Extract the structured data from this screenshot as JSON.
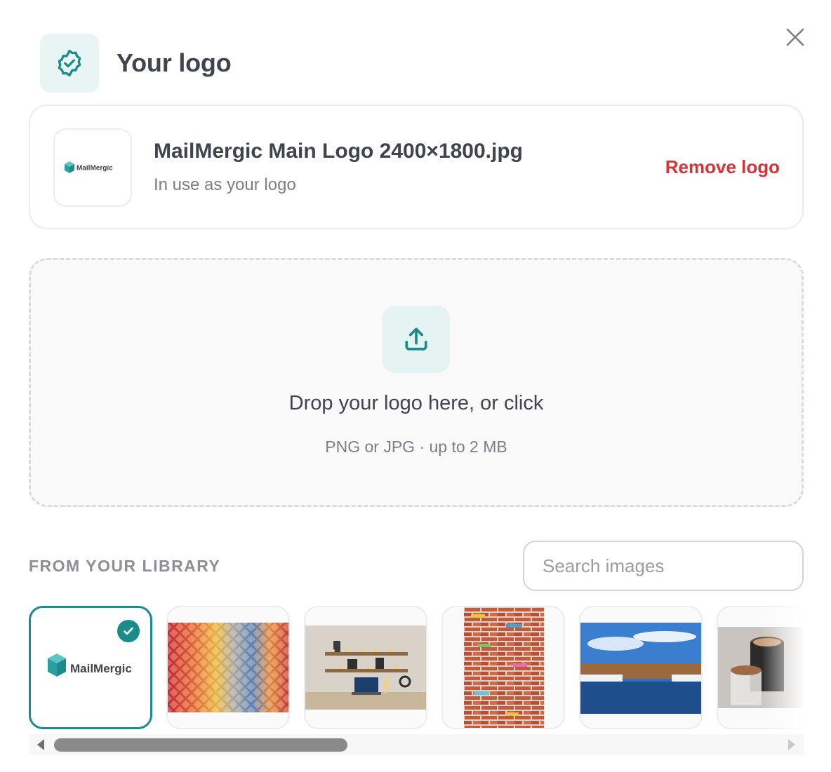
{
  "header": {
    "title": "Your logo",
    "icon": "badge-check-icon"
  },
  "close": {
    "icon": "close-icon"
  },
  "current_logo": {
    "filename": "MailMergic Main Logo 2400×1800.jpg",
    "status": "In use as your logo",
    "remove_label": "Remove logo",
    "brand_text": "MailMergic"
  },
  "dropzone": {
    "title": "Drop your logo here, or click",
    "subtitle": "PNG or JPG · up to 2 MB",
    "icon": "upload-icon"
  },
  "library": {
    "label": "FROM YOUR LIBRARY",
    "search_placeholder": "Search images",
    "items": [
      {
        "name": "mailmergic-logo",
        "brand_text": "MailMergic",
        "selected": true
      },
      {
        "name": "colorful-mosaic-tiles",
        "selected": false
      },
      {
        "name": "desk-setup-shelves",
        "selected": false
      },
      {
        "name": "painted-brick-wall",
        "selected": false
      },
      {
        "name": "river-landscape",
        "selected": false
      },
      {
        "name": "coffee-cups",
        "selected": false
      }
    ]
  },
  "colors": {
    "accent": "#1b8c8a",
    "danger": "#d6333a",
    "text": "#3f444d",
    "muted": "#7a7e86"
  }
}
